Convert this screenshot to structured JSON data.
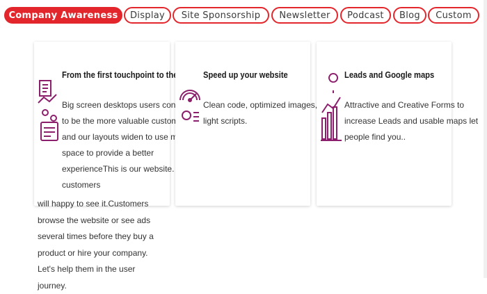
{
  "tabs": [
    {
      "label": "Company Awareness",
      "active": true
    },
    {
      "label": "Display",
      "active": false
    },
    {
      "label": "Site Sponsorship",
      "active": false
    },
    {
      "label": "Newsletter",
      "active": false
    },
    {
      "label": "Podcast",
      "active": false
    },
    {
      "label": "Blog",
      "active": false
    },
    {
      "label": "Custom",
      "active": false
    }
  ],
  "cards": [
    {
      "title": "From the first touchpoint to the sale",
      "text": "Big screen desktops users continue to be the more valuable customers, and our layouts widen to use more space to provide a better experienceThis is our website. Our customers",
      "overflow_text": "will happy to see it.Customers browse the website or see ads several times before they buy a product or hire your company. Let's help them in the user journey.",
      "icon": "analytics-report-icon"
    },
    {
      "title": "Speed up your website",
      "text": "Clean code, optimized images, and light scripts.",
      "icon": "speedometer-icon"
    },
    {
      "title": "Leads and Google maps",
      "text": "Attractive and Creative Forms to increase Leads and usable maps let people find you..",
      "icon": "growth-chart-pin-icon"
    }
  ],
  "colors": {
    "accent": "#e3262c",
    "icon": "#8b1f6b"
  }
}
